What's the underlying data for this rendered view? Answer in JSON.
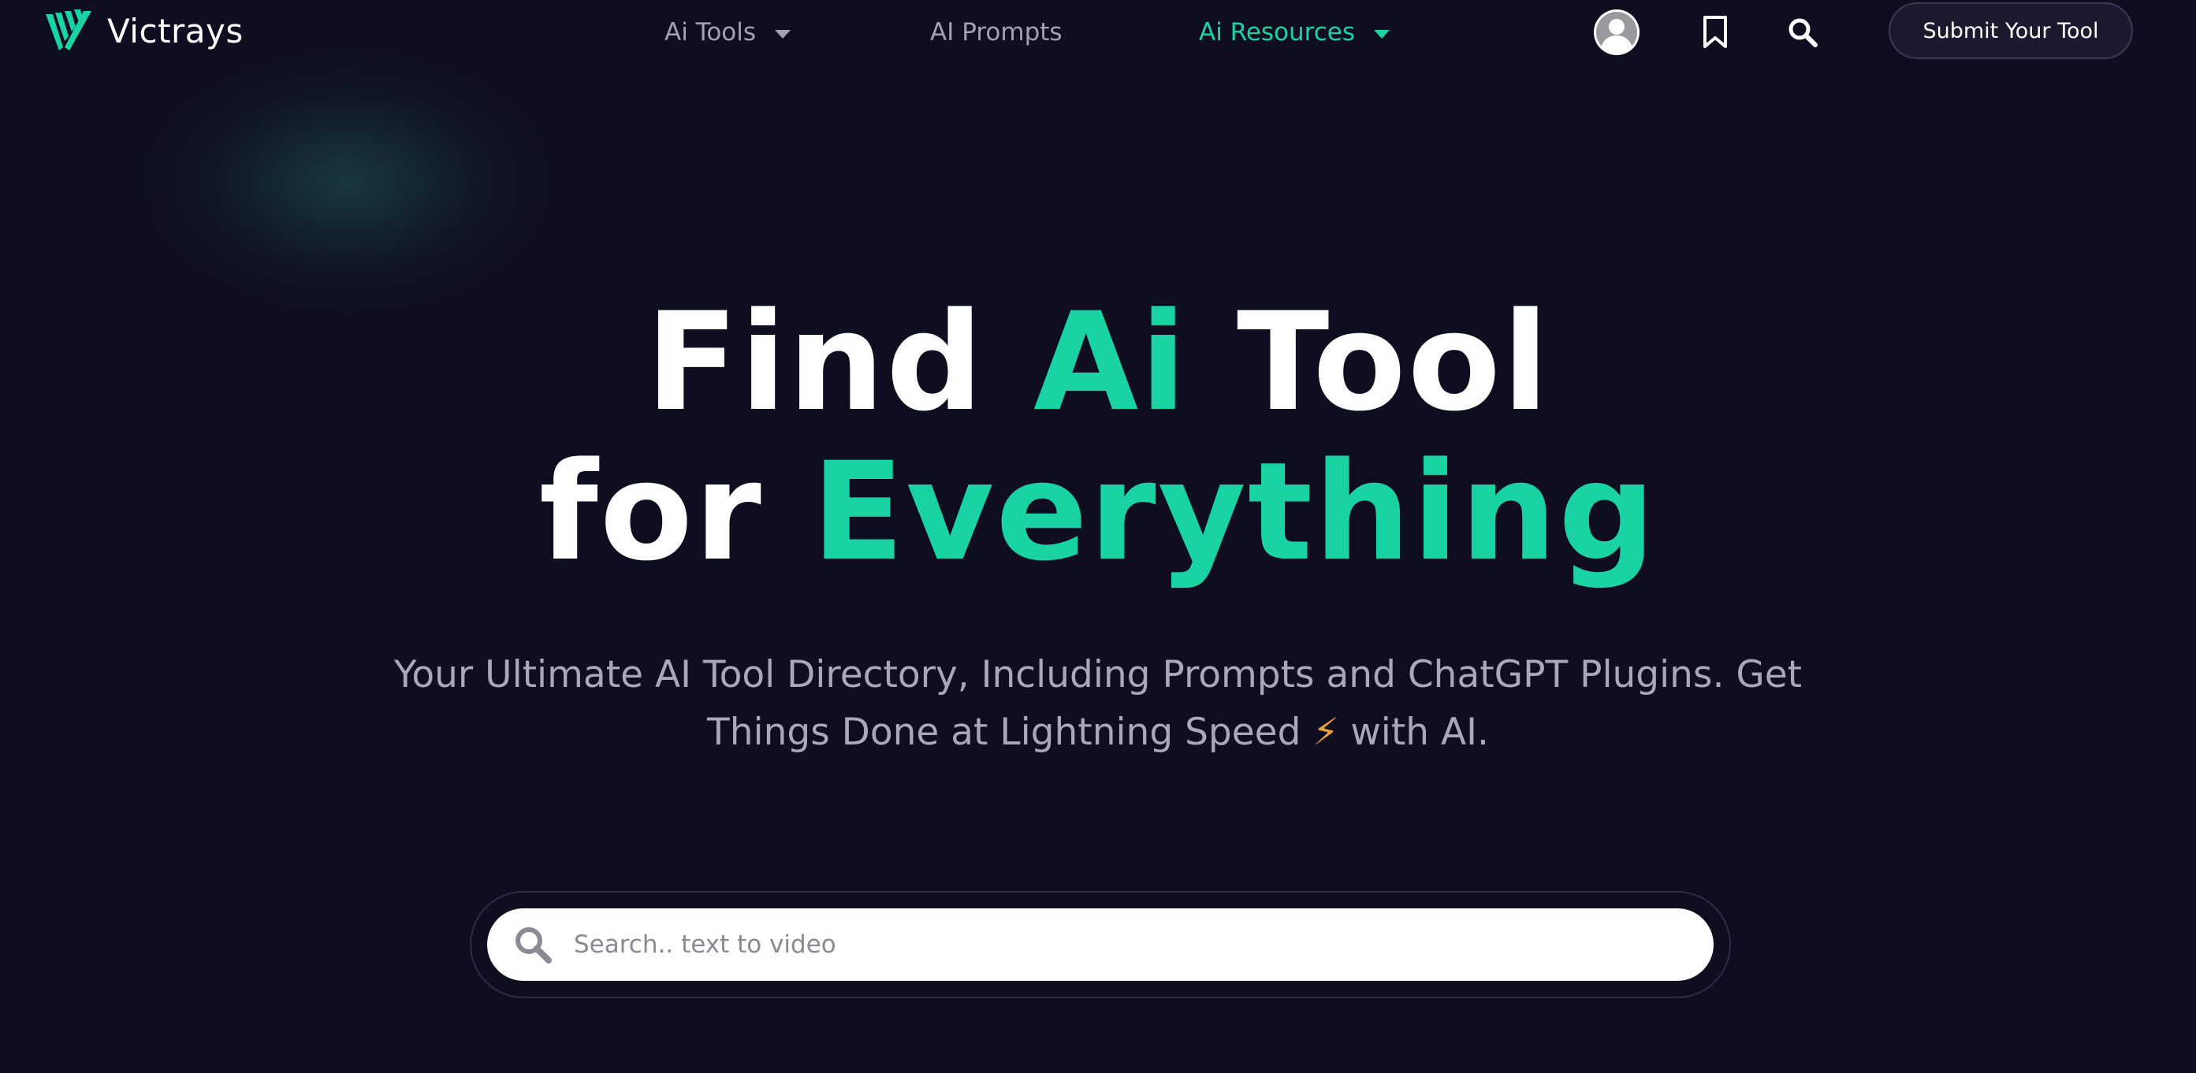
{
  "brand": {
    "name": "Victrays",
    "accent_color": "#19d3a2",
    "background_color": "#0f0d20"
  },
  "nav": {
    "items": [
      {
        "label": "Ai Tools",
        "has_dropdown": true,
        "active": false
      },
      {
        "label": "AI Prompts",
        "has_dropdown": false,
        "active": false
      },
      {
        "label": "Ai Resources",
        "has_dropdown": true,
        "active": true
      }
    ],
    "icons": [
      "user-avatar-icon",
      "bookmark-icon",
      "search-icon"
    ],
    "submit_label": "Submit Your Tool"
  },
  "hero": {
    "line1_part1": "Find ",
    "line1_accent": "Ai",
    "line1_part2": " Tool",
    "line2_part1": "for ",
    "line2_accent": "Everything",
    "subtitle_part1": "Your Ultimate AI Tool Directory, Including Prompts and ChatGPT Plugins. Get Things Done at Lightning Speed ",
    "subtitle_bolt": "⚡",
    "subtitle_part2": " with AI."
  },
  "search": {
    "placeholder": "Search.. text to video",
    "value": ""
  }
}
